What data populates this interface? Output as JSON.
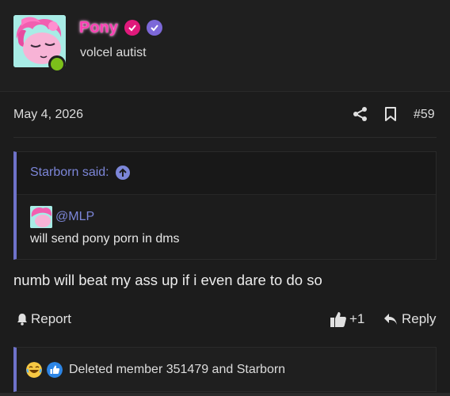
{
  "author": {
    "username": "Pony",
    "title": "volcel autist",
    "badges": [
      "verified-badge-icon",
      "staff-badge-icon"
    ],
    "online": true,
    "colors": {
      "username": "#ff3fb4",
      "badge_pink": "#e0197b",
      "badge_purple": "#7c68d8",
      "online": "#7cbf1a"
    }
  },
  "post": {
    "date": "May 4, 2026",
    "number": "#59",
    "body": "numb will beat my ass up if i even dare to do so"
  },
  "quote": {
    "author_said": "Starborn said:",
    "mention": "@MLP",
    "text": "will send pony porn in dms",
    "accent": "#6e72c9"
  },
  "actions": {
    "report_label": "Report",
    "like_count": "+1",
    "reply_label": "Reply"
  },
  "reactions": {
    "icons": [
      "laughing-emoji-icon",
      "like-reaction-icon"
    ],
    "summary": "Deleted member 351479 and Starborn"
  }
}
